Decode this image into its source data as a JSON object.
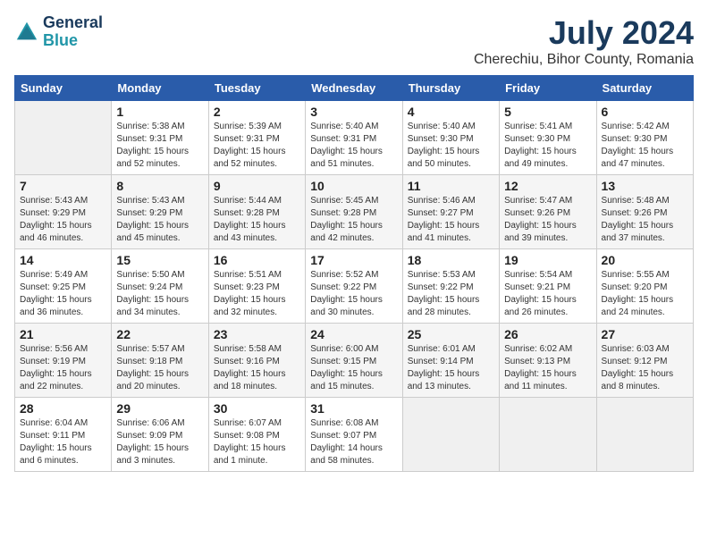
{
  "logo": {
    "line1": "General",
    "line2": "Blue"
  },
  "title": "July 2024",
  "location": "Cherechiu, Bihor County, Romania",
  "days_header": [
    "Sunday",
    "Monday",
    "Tuesday",
    "Wednesday",
    "Thursday",
    "Friday",
    "Saturday"
  ],
  "weeks": [
    [
      {
        "day": "",
        "info": ""
      },
      {
        "day": "1",
        "info": "Sunrise: 5:38 AM\nSunset: 9:31 PM\nDaylight: 15 hours\nand 52 minutes."
      },
      {
        "day": "2",
        "info": "Sunrise: 5:39 AM\nSunset: 9:31 PM\nDaylight: 15 hours\nand 52 minutes."
      },
      {
        "day": "3",
        "info": "Sunrise: 5:40 AM\nSunset: 9:31 PM\nDaylight: 15 hours\nand 51 minutes."
      },
      {
        "day": "4",
        "info": "Sunrise: 5:40 AM\nSunset: 9:30 PM\nDaylight: 15 hours\nand 50 minutes."
      },
      {
        "day": "5",
        "info": "Sunrise: 5:41 AM\nSunset: 9:30 PM\nDaylight: 15 hours\nand 49 minutes."
      },
      {
        "day": "6",
        "info": "Sunrise: 5:42 AM\nSunset: 9:30 PM\nDaylight: 15 hours\nand 47 minutes."
      }
    ],
    [
      {
        "day": "7",
        "info": "Sunrise: 5:43 AM\nSunset: 9:29 PM\nDaylight: 15 hours\nand 46 minutes."
      },
      {
        "day": "8",
        "info": "Sunrise: 5:43 AM\nSunset: 9:29 PM\nDaylight: 15 hours\nand 45 minutes."
      },
      {
        "day": "9",
        "info": "Sunrise: 5:44 AM\nSunset: 9:28 PM\nDaylight: 15 hours\nand 43 minutes."
      },
      {
        "day": "10",
        "info": "Sunrise: 5:45 AM\nSunset: 9:28 PM\nDaylight: 15 hours\nand 42 minutes."
      },
      {
        "day": "11",
        "info": "Sunrise: 5:46 AM\nSunset: 9:27 PM\nDaylight: 15 hours\nand 41 minutes."
      },
      {
        "day": "12",
        "info": "Sunrise: 5:47 AM\nSunset: 9:26 PM\nDaylight: 15 hours\nand 39 minutes."
      },
      {
        "day": "13",
        "info": "Sunrise: 5:48 AM\nSunset: 9:26 PM\nDaylight: 15 hours\nand 37 minutes."
      }
    ],
    [
      {
        "day": "14",
        "info": "Sunrise: 5:49 AM\nSunset: 9:25 PM\nDaylight: 15 hours\nand 36 minutes."
      },
      {
        "day": "15",
        "info": "Sunrise: 5:50 AM\nSunset: 9:24 PM\nDaylight: 15 hours\nand 34 minutes."
      },
      {
        "day": "16",
        "info": "Sunrise: 5:51 AM\nSunset: 9:23 PM\nDaylight: 15 hours\nand 32 minutes."
      },
      {
        "day": "17",
        "info": "Sunrise: 5:52 AM\nSunset: 9:22 PM\nDaylight: 15 hours\nand 30 minutes."
      },
      {
        "day": "18",
        "info": "Sunrise: 5:53 AM\nSunset: 9:22 PM\nDaylight: 15 hours\nand 28 minutes."
      },
      {
        "day": "19",
        "info": "Sunrise: 5:54 AM\nSunset: 9:21 PM\nDaylight: 15 hours\nand 26 minutes."
      },
      {
        "day": "20",
        "info": "Sunrise: 5:55 AM\nSunset: 9:20 PM\nDaylight: 15 hours\nand 24 minutes."
      }
    ],
    [
      {
        "day": "21",
        "info": "Sunrise: 5:56 AM\nSunset: 9:19 PM\nDaylight: 15 hours\nand 22 minutes."
      },
      {
        "day": "22",
        "info": "Sunrise: 5:57 AM\nSunset: 9:18 PM\nDaylight: 15 hours\nand 20 minutes."
      },
      {
        "day": "23",
        "info": "Sunrise: 5:58 AM\nSunset: 9:16 PM\nDaylight: 15 hours\nand 18 minutes."
      },
      {
        "day": "24",
        "info": "Sunrise: 6:00 AM\nSunset: 9:15 PM\nDaylight: 15 hours\nand 15 minutes."
      },
      {
        "day": "25",
        "info": "Sunrise: 6:01 AM\nSunset: 9:14 PM\nDaylight: 15 hours\nand 13 minutes."
      },
      {
        "day": "26",
        "info": "Sunrise: 6:02 AM\nSunset: 9:13 PM\nDaylight: 15 hours\nand 11 minutes."
      },
      {
        "day": "27",
        "info": "Sunrise: 6:03 AM\nSunset: 9:12 PM\nDaylight: 15 hours\nand 8 minutes."
      }
    ],
    [
      {
        "day": "28",
        "info": "Sunrise: 6:04 AM\nSunset: 9:11 PM\nDaylight: 15 hours\nand 6 minutes."
      },
      {
        "day": "29",
        "info": "Sunrise: 6:06 AM\nSunset: 9:09 PM\nDaylight: 15 hours\nand 3 minutes."
      },
      {
        "day": "30",
        "info": "Sunrise: 6:07 AM\nSunset: 9:08 PM\nDaylight: 15 hours\nand 1 minute."
      },
      {
        "day": "31",
        "info": "Sunrise: 6:08 AM\nSunset: 9:07 PM\nDaylight: 14 hours\nand 58 minutes."
      },
      {
        "day": "",
        "info": ""
      },
      {
        "day": "",
        "info": ""
      },
      {
        "day": "",
        "info": ""
      }
    ]
  ]
}
